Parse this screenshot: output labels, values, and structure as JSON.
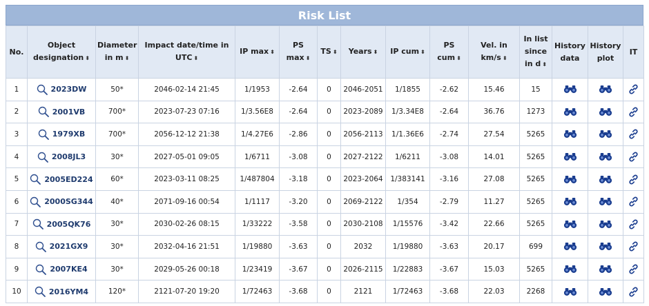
{
  "title": "Risk List",
  "columns": [
    {
      "label": "No.",
      "sort": false
    },
    {
      "label": "Object designation",
      "sort": true
    },
    {
      "label": "Diameter in m",
      "sort": true
    },
    {
      "label": "Impact date/time in UTC",
      "sort": true
    },
    {
      "label": "IP max",
      "sort": true
    },
    {
      "label": "PS max",
      "sort": true
    },
    {
      "label": "TS",
      "sort": true
    },
    {
      "label": "Years",
      "sort": true
    },
    {
      "label": "IP cum",
      "sort": true
    },
    {
      "label": "PS cum",
      "sort": true
    },
    {
      "label": "Vel. in km/s",
      "sort": true
    },
    {
      "label": "In list since in d",
      "sort": true
    },
    {
      "label": "History data",
      "sort": false
    },
    {
      "label": "History plot",
      "sort": false
    },
    {
      "label": "IT",
      "sort": false
    }
  ],
  "sort_glyph": "⬍",
  "icons": {
    "designation": "magnifier-icon",
    "history_data": "binoculars-icon",
    "history_plot": "binoculars-icon",
    "it": "link-icon"
  },
  "colors": {
    "header_bg": "#e1e9f4",
    "title_bg": "#9fb7d9",
    "icon": "#1a3d8f",
    "link": "#1f3b6e"
  },
  "rows": [
    {
      "no": "1",
      "designation": "2023DW",
      "diameter": "50*",
      "impact": "2046-02-14 21:45",
      "ip_max": "1/1953",
      "ps_max": "-2.64",
      "ts": "0",
      "years": "2046-2051",
      "ip_cum": "1/1855",
      "ps_cum": "-2.62",
      "vel": "15.46",
      "since": "15"
    },
    {
      "no": "2",
      "designation": "2001VB",
      "diameter": "700*",
      "impact": "2023-07-23 07:16",
      "ip_max": "1/3.56E8",
      "ps_max": "-2.64",
      "ts": "0",
      "years": "2023-2089",
      "ip_cum": "1/3.34E8",
      "ps_cum": "-2.64",
      "vel": "36.76",
      "since": "1273"
    },
    {
      "no": "3",
      "designation": "1979XB",
      "diameter": "700*",
      "impact": "2056-12-12 21:38",
      "ip_max": "1/4.27E6",
      "ps_max": "-2.86",
      "ts": "0",
      "years": "2056-2113",
      "ip_cum": "1/1.36E6",
      "ps_cum": "-2.74",
      "vel": "27.54",
      "since": "5265"
    },
    {
      "no": "4",
      "designation": "2008JL3",
      "diameter": "30*",
      "impact": "2027-05-01 09:05",
      "ip_max": "1/6711",
      "ps_max": "-3.08",
      "ts": "0",
      "years": "2027-2122",
      "ip_cum": "1/6211",
      "ps_cum": "-3.08",
      "vel": "14.01",
      "since": "5265"
    },
    {
      "no": "5",
      "designation": "2005ED224",
      "diameter": "60*",
      "impact": "2023-03-11 08:25",
      "ip_max": "1/487804",
      "ps_max": "-3.18",
      "ts": "0",
      "years": "2023-2064",
      "ip_cum": "1/383141",
      "ps_cum": "-3.16",
      "vel": "27.08",
      "since": "5265"
    },
    {
      "no": "6",
      "designation": "2000SG344",
      "diameter": "40*",
      "impact": "2071-09-16 00:54",
      "ip_max": "1/1117",
      "ps_max": "-3.20",
      "ts": "0",
      "years": "2069-2122",
      "ip_cum": "1/354",
      "ps_cum": "-2.79",
      "vel": "11.27",
      "since": "5265"
    },
    {
      "no": "7",
      "designation": "2005QK76",
      "diameter": "30*",
      "impact": "2030-02-26 08:15",
      "ip_max": "1/33222",
      "ps_max": "-3.58",
      "ts": "0",
      "years": "2030-2108",
      "ip_cum": "1/15576",
      "ps_cum": "-3.42",
      "vel": "22.66",
      "since": "5265"
    },
    {
      "no": "8",
      "designation": "2021GX9",
      "diameter": "30*",
      "impact": "2032-04-16 21:51",
      "ip_max": "1/19880",
      "ps_max": "-3.63",
      "ts": "0",
      "years": "2032",
      "ip_cum": "1/19880",
      "ps_cum": "-3.63",
      "vel": "20.17",
      "since": "699"
    },
    {
      "no": "9",
      "designation": "2007KE4",
      "diameter": "30*",
      "impact": "2029-05-26 00:18",
      "ip_max": "1/23419",
      "ps_max": "-3.67",
      "ts": "0",
      "years": "2026-2115",
      "ip_cum": "1/22883",
      "ps_cum": "-3.67",
      "vel": "15.03",
      "since": "5265"
    },
    {
      "no": "10",
      "designation": "2016YM4",
      "diameter": "120*",
      "impact": "2121-07-20 19:20",
      "ip_max": "1/72463",
      "ps_max": "-3.68",
      "ts": "0",
      "years": "2121",
      "ip_cum": "1/72463",
      "ps_cum": "-3.68",
      "vel": "22.03",
      "since": "2268"
    }
  ]
}
